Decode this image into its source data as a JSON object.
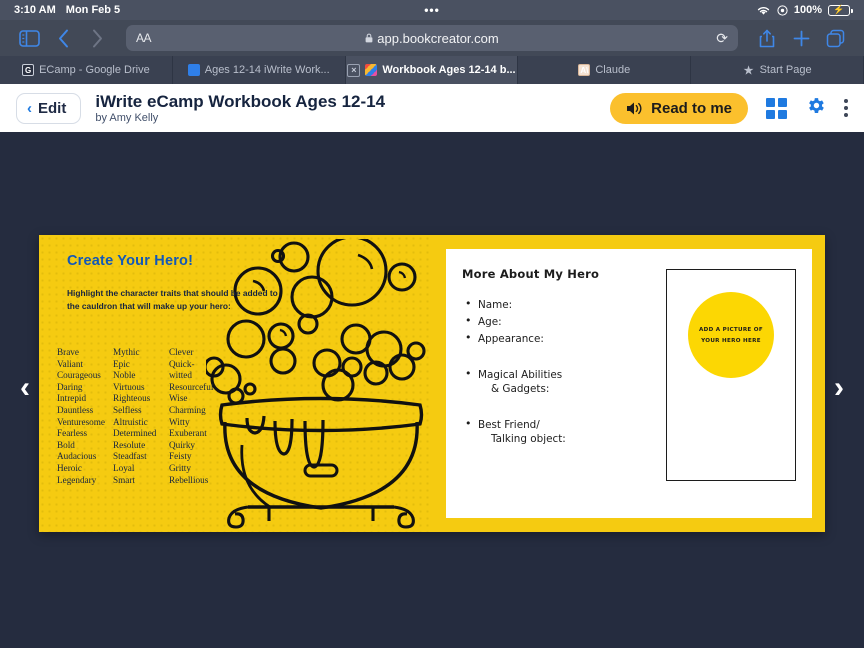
{
  "status_bar": {
    "time": "3:10 AM",
    "date": "Mon Feb 5",
    "dots": "•••",
    "battery_percent": "100%",
    "wifi_icon": "wifi-icon",
    "location_icon": "location-icon",
    "battery_icon": "battery-charging-icon"
  },
  "browser": {
    "sidebar_icon": "sidebar-icon",
    "back_icon": "chevron-left-icon",
    "forward_icon": "chevron-right-icon",
    "text_size_label": "AA",
    "lock_icon": "lock-icon",
    "url": "app.bookcreator.com",
    "reload_icon": "reload-icon",
    "share_icon": "share-icon",
    "new_tab_icon": "plus-icon",
    "tabs_overview_icon": "tabs-icon",
    "tabs": [
      {
        "title": "ECamp - Google Drive",
        "favicon": "google-drive-icon",
        "favicon_letter": "G",
        "active": false,
        "closable": false
      },
      {
        "title": "Ages 12-14 iWrite Work...",
        "favicon": "document-icon",
        "favicon_letter": "",
        "active": false,
        "closable": false
      },
      {
        "title": "Workbook Ages 12-14 b...",
        "favicon": "bookcreator-icon",
        "favicon_letter": "",
        "active": true,
        "closable": true,
        "close_label": "×"
      },
      {
        "title": "Claude",
        "favicon": "claude-icon",
        "favicon_letter": "A\\",
        "active": false,
        "closable": false
      },
      {
        "title": "Start Page",
        "favicon": "star-icon",
        "favicon_letter": "★",
        "active": false,
        "closable": false
      }
    ]
  },
  "appbar": {
    "edit_label": "Edit",
    "edit_chevron": "‹",
    "book_title": "iWrite eCamp Workbook Ages 12-14",
    "book_author": "by Amy Kelly",
    "read_to_me_label": "Read to me",
    "speaker_icon": "speaker-icon",
    "pages_icon": "grid-pages-icon",
    "settings_icon": "gear-icon",
    "more_icon": "kebab-menu-icon",
    "accent_yellow": "#fbc02d",
    "accent_blue": "#1f7ae0"
  },
  "reader": {
    "prev_arrow": "‹",
    "next_arrow": "›",
    "page_background": "#f5cb11",
    "stage_background": "#252c3f"
  },
  "left_page": {
    "title": "Create Your Hero!",
    "instructions": "Highlight the character traits that should be added to the cauldron that will make up your hero:",
    "illustration": "cauldron-with-bubbles-illustration",
    "trait_columns": [
      [
        "Brave",
        "Valiant",
        "Courageous",
        "Daring",
        "Intrepid",
        "Dauntless",
        "Venturesome",
        "Fearless",
        "Bold",
        "Audacious",
        "Heroic",
        "Legendary"
      ],
      [
        "Mythic",
        "Epic",
        "Noble",
        "Virtuous",
        "Righteous",
        "Selfless",
        "Altruistic",
        "Determined",
        "Resolute",
        "Steadfast",
        "Loyal",
        "Smart"
      ],
      [
        "Clever",
        "Quick-",
        "witted",
        "Resourceful",
        "Wise",
        "Charming",
        "Witty",
        "Exuberant",
        "Quirky",
        "Feisty",
        "Gritty",
        "Rebellious"
      ]
    ]
  },
  "right_page": {
    "heading": "More About My Hero",
    "items": [
      {
        "label": "Name:",
        "continuation": "",
        "gap": false
      },
      {
        "label": "Age:",
        "continuation": "",
        "gap": false
      },
      {
        "label": "Appearance:",
        "continuation": "",
        "gap": false
      },
      {
        "label": "Magical Abilities",
        "continuation": "& Gadgets:",
        "gap": true
      },
      {
        "label": "Best Friend/",
        "continuation": "Talking object:",
        "gap": true
      }
    ],
    "photo_placeholder_line1": "ADD A PICTURE OF",
    "photo_placeholder_line2": "YOUR HERO HERE",
    "photo_circle_color": "#fcd703"
  }
}
